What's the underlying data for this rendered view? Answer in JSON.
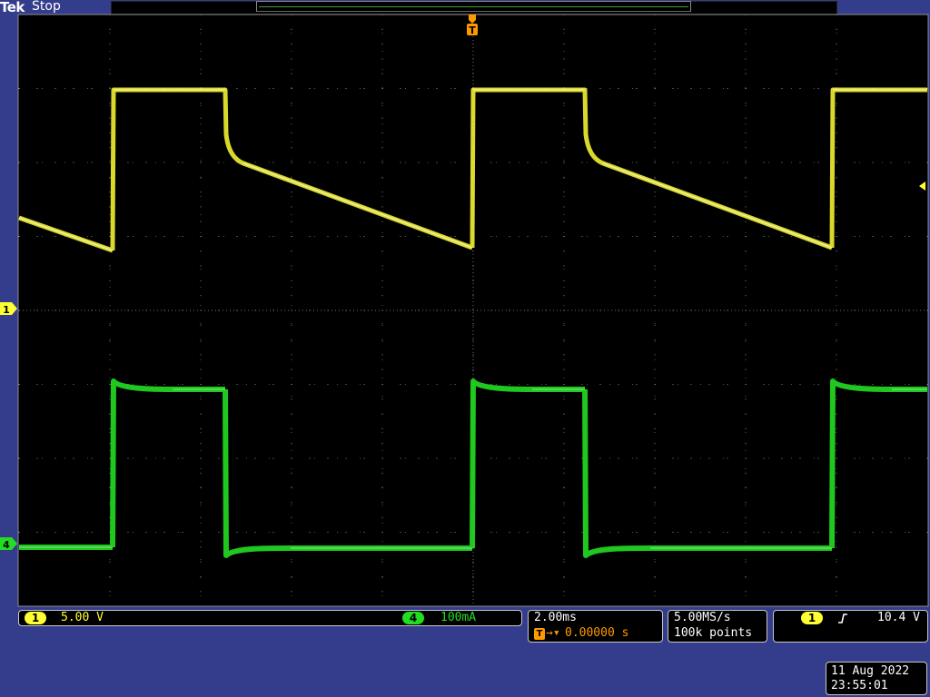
{
  "header": {
    "brand": "Tek",
    "run_state": "Stop"
  },
  "markers": {
    "trigger_pos": "T",
    "ch1_ground": "1",
    "ch4_ground": "4"
  },
  "channels": {
    "ch1": {
      "id": "1",
      "scale": "5.00 V",
      "color": "#ffff33"
    },
    "ch4": {
      "id": "4",
      "scale": "100mA",
      "color": "#22dd22"
    }
  },
  "timebase": {
    "scale": "2.00ms",
    "delay": "0.00000 s",
    "sample_rate": "5.00MS/s",
    "record_length": "100k points"
  },
  "trigger": {
    "source": "1",
    "slope_icon": "rising-edge-icon",
    "level": "10.4 V"
  },
  "datetime": {
    "date": "11 Aug 2022",
    "time": "23:55:01"
  },
  "colors": {
    "background": "#343c8c",
    "graticule_bg": "#000000",
    "ch1": "#ffff33",
    "ch4": "#22dd22",
    "trigger": "#ff9900"
  }
}
